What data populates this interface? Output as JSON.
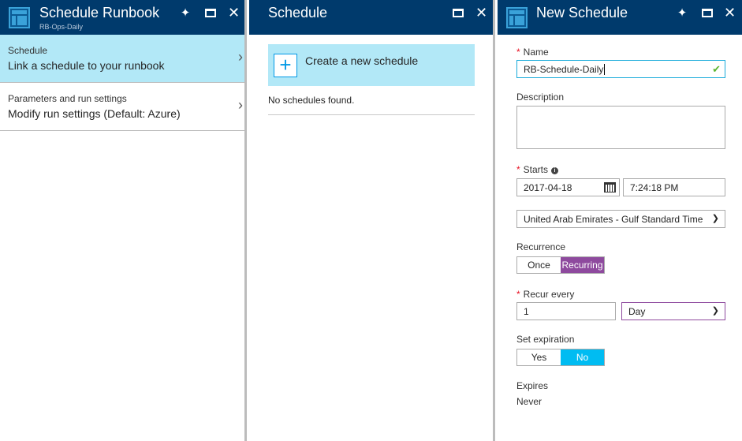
{
  "blade1": {
    "title": "Schedule Runbook",
    "subtitle": "RB-Ops-Daily",
    "items": [
      {
        "label": "Schedule",
        "value": "Link a schedule to your runbook"
      },
      {
        "label": "Parameters and run settings",
        "value": "Modify run settings (Default: Azure)"
      }
    ]
  },
  "blade2": {
    "title": "Schedule",
    "create_label": "Create a new schedule",
    "empty_text": "No schedules found."
  },
  "blade3": {
    "title": "New Schedule",
    "name": {
      "label": "Name",
      "value": "RB-Schedule-Daily"
    },
    "description": {
      "label": "Description",
      "value": ""
    },
    "starts": {
      "label": "Starts",
      "date": "2017-04-18",
      "time": "7:24:18 PM"
    },
    "timezone": "United Arab Emirates - Gulf Standard Time",
    "recurrence": {
      "label": "Recurrence",
      "options": [
        "Once",
        "Recurring"
      ],
      "selected": "Recurring"
    },
    "recur_every": {
      "label": "Recur every",
      "value": "1",
      "unit": "Day"
    },
    "set_expiration": {
      "label": "Set expiration",
      "options": [
        "Yes",
        "No"
      ],
      "selected": "No"
    },
    "expires": {
      "label": "Expires",
      "value": "Never"
    }
  },
  "icons": {
    "pin": "pin-icon",
    "maximize": "maximize-icon",
    "close": "close-icon",
    "chevron": "chevron-right-icon",
    "check": "check-icon",
    "calendar": "calendar-icon",
    "info": "info-icon",
    "plus": "plus-icon"
  },
  "colors": {
    "header": "#003a6c",
    "selected": "#b2e8f7",
    "recurring": "#8e4a9e",
    "no_toggle": "#00bcf2",
    "accent": "#0099e6"
  }
}
